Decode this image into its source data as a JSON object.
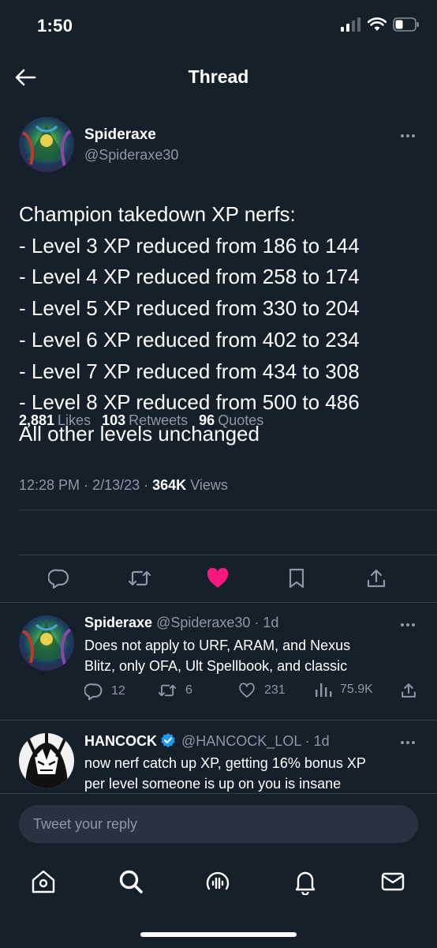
{
  "status_bar": {
    "time": "1:50"
  },
  "header": {
    "title": "Thread"
  },
  "main_tweet": {
    "author_name": "Spideraxe",
    "author_handle": "@Spideraxe30",
    "lines": [
      "Champion takedown XP nerfs:",
      "- Level 3 XP reduced from 186 to 144",
      "- Level 4 XP reduced from 258 to 174",
      "- Level 5 XP reduced from 330 to 204",
      "- Level 6 XP reduced from 402 to 234",
      "- Level 7 XP reduced from 434 to 308",
      "- Level 8 XP reduced from 500 to 486",
      "All other levels unchanged"
    ],
    "time": "12:28 PM",
    "date": "2/13/23",
    "views_count": "364K",
    "views_label": "Views",
    "likes_count": "2,881",
    "likes_label": "Likes",
    "retweets_count": "103",
    "retweets_label": "Retweets",
    "quotes_count": "96",
    "quotes_label": "Quotes",
    "liked": true,
    "like_color": "#f91880"
  },
  "replies": [
    {
      "author_name": "Spideraxe",
      "author_handle": "@Spideraxe30",
      "age": "1d",
      "verified": false,
      "text_lines": [
        "Does not apply to URF, ARAM, and Nexus",
        "Blitz, only OFA, Ult Spellbook, and classic"
      ],
      "reply_count": "12",
      "retweet_count": "6",
      "like_count": "231",
      "view_count": "75.9K"
    },
    {
      "author_name": "HANCOCK",
      "author_handle": "@HANCOCK_LOL",
      "age": "1d",
      "verified": true,
      "text_lines": [
        "now nerf catch up XP, getting 16% bonus XP",
        "per level someone is up on you is insane"
      ]
    }
  ],
  "composer": {
    "placeholder": "Tweet your reply"
  },
  "colors": {
    "background": "#15202b",
    "secondary_text": "#8b98a5",
    "divider": "#38444d",
    "accent": "#1d9bf0"
  },
  "icons": {
    "back": "arrow-left-icon",
    "more": "more-horizontal-icon",
    "reply": "reply-bubble-icon",
    "retweet": "retweet-icon",
    "like": "heart-icon",
    "bookmark": "bookmark-icon",
    "share": "share-icon",
    "nav": [
      "home-icon",
      "search-icon",
      "spaces-icon",
      "notifications-icon",
      "messages-icon"
    ]
  }
}
